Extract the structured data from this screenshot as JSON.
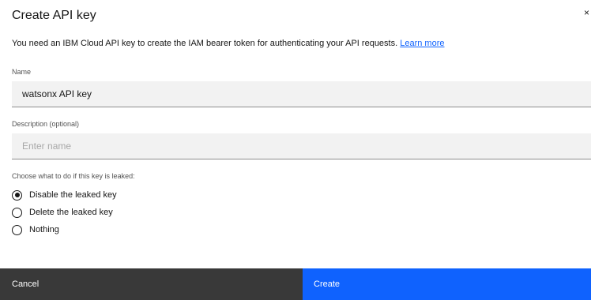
{
  "dialog": {
    "title": "Create API key",
    "close_glyph": "×",
    "intro_text": "You need an IBM Cloud API key to create the IAM bearer token for authenticating your API requests.",
    "learn_more": "Learn more"
  },
  "form": {
    "name_label": "Name",
    "name_value": "watsonx API key",
    "description_label": "Description (optional)",
    "description_placeholder": "Enter name",
    "leak_label": "Choose what to do if this key is leaked:",
    "leak_options": [
      {
        "label": "Disable the leaked key",
        "selected": true
      },
      {
        "label": "Delete the leaked key",
        "selected": false
      },
      {
        "label": "Nothing",
        "selected": false
      }
    ]
  },
  "footer": {
    "cancel_label": "Cancel",
    "create_label": "Create"
  },
  "colors": {
    "primary": "#0f62fe",
    "secondary": "#393939",
    "field_bg": "#f2f2f2"
  }
}
